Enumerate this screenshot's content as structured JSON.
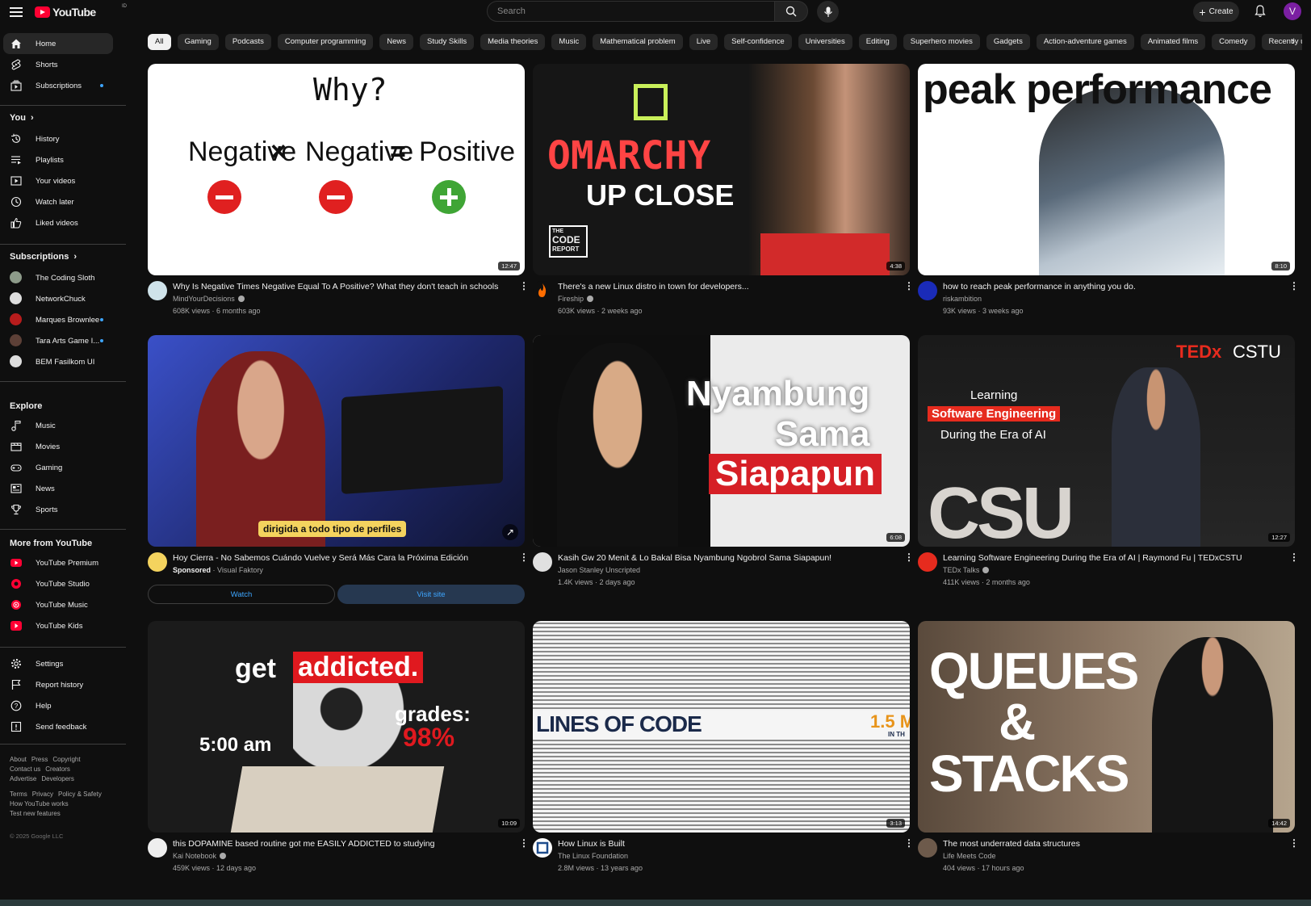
{
  "app": {
    "name": "YouTube",
    "region_code": "ID"
  },
  "header": {
    "search_placeholder": "Search",
    "create_label": "Create",
    "avatar_letter": "V"
  },
  "sidebar": {
    "main": [
      {
        "label": "Home",
        "icon": "home-icon",
        "active": true
      },
      {
        "label": "Shorts",
        "icon": "shorts-icon"
      },
      {
        "label": "Subscriptions",
        "icon": "subscriptions-icon",
        "dot": true
      }
    ],
    "you_header": "You",
    "you": [
      {
        "label": "History",
        "icon": "history-icon"
      },
      {
        "label": "Playlists",
        "icon": "playlists-icon"
      },
      {
        "label": "Your videos",
        "icon": "your-videos-icon"
      },
      {
        "label": "Watch later",
        "icon": "watch-later-icon"
      },
      {
        "label": "Liked videos",
        "icon": "liked-videos-icon"
      }
    ],
    "subs_header": "Subscriptions",
    "subs": [
      {
        "label": "The Coding Sloth",
        "color": "#8d9b8a"
      },
      {
        "label": "NetworkChuck",
        "color": "#dddddd"
      },
      {
        "label": "Marques Brownlee",
        "color": "#b71c1c",
        "dot": true
      },
      {
        "label": "Tara Arts Game I...",
        "color": "#5d4037",
        "dot": true
      },
      {
        "label": "BEM Fasilkom UI",
        "color": "#dddddd"
      }
    ],
    "explore_header": "Explore",
    "explore": [
      {
        "label": "Music",
        "icon": "music-icon"
      },
      {
        "label": "Movies",
        "icon": "movies-icon"
      },
      {
        "label": "Gaming",
        "icon": "gaming-icon"
      },
      {
        "label": "News",
        "icon": "news-icon"
      },
      {
        "label": "Sports",
        "icon": "sports-icon"
      }
    ],
    "more_header": "More from YouTube",
    "more": [
      {
        "label": "YouTube Premium",
        "icon": "youtube-premium-icon"
      },
      {
        "label": "YouTube Studio",
        "icon": "youtube-studio-icon"
      },
      {
        "label": "YouTube Music",
        "icon": "youtube-music-icon"
      },
      {
        "label": "YouTube Kids",
        "icon": "youtube-kids-icon"
      }
    ],
    "settings": [
      {
        "label": "Settings",
        "icon": "gear-icon"
      },
      {
        "label": "Report history",
        "icon": "flag-icon"
      },
      {
        "label": "Help",
        "icon": "help-icon"
      },
      {
        "label": "Send feedback",
        "icon": "feedback-icon"
      }
    ],
    "footer1": [
      "About",
      "Press",
      "Copyright",
      "Contact us",
      "Creators",
      "Advertise",
      "Developers"
    ],
    "footer2": [
      "Terms",
      "Privacy",
      "Policy & Safety",
      "How YouTube works",
      "Test new features"
    ],
    "copyright": "© 2025 Google LLC"
  },
  "chips": [
    "All",
    "Gaming",
    "Podcasts",
    "Computer programming",
    "News",
    "Study Skills",
    "Media theories",
    "Music",
    "Mathematical problem",
    "Live",
    "Self-confidence",
    "Universities",
    "Editing",
    "Superhero movies",
    "Gadgets",
    "Action-adventure games",
    "Animated films",
    "Comedy",
    "Recently uploaded"
  ],
  "videos": [
    {
      "title": "Why Is Negative Times Negative Equal To A Positive? What they don't teach in schools",
      "channel": "MindYourDecisions",
      "verified": true,
      "meta": "608K views · 6 months ago",
      "duration": "12:47",
      "thumb_text": [
        "Why?",
        "Negative",
        "×",
        "Negative",
        "=",
        "Positive"
      ]
    },
    {
      "title": "There's a new Linux distro in town for developers...",
      "channel": "Fireship",
      "verified": true,
      "meta": "603K views · 2 weeks ago",
      "duration": "4:38",
      "thumb_text": [
        "OMARCHY",
        "UP CLOSE",
        "THE",
        "CODE",
        "REPORT"
      ]
    },
    {
      "title": "how to reach peak performance in anything you do.",
      "channel": "riskambition",
      "verified": false,
      "meta": "93K views · 3 weeks ago",
      "duration": "8:10",
      "thumb_text": [
        "peak performance"
      ]
    },
    {
      "title": "Hoy Cierra - No Sabemos Cuándo Vuelve y Será Más Cara la Próxima Edición",
      "sponsored": "Sponsored",
      "channel": "Visual Faktory",
      "watch_label": "Watch",
      "visit_label": "Visit site",
      "thumb_text": [
        "dirigida a todo tipo de perfiles"
      ]
    },
    {
      "title": "Kasih Gw 20 Menit & Lo Bakal Bisa Nyambung Ngobrol Sama Siapapun!",
      "channel": "Jason Stanley Unscripted",
      "verified": false,
      "meta": "1.4K views · 2 days ago",
      "duration": "6:08",
      "thumb_text": [
        "Nyambung",
        "Sama",
        "Siapapun"
      ]
    },
    {
      "title": "Learning Software Engineering During the Era of AI | Raymond Fu | TEDxCSTU",
      "channel": "TEDx Talks",
      "verified": true,
      "meta": "411K views · 2 months ago",
      "duration": "12:27",
      "thumb_text": [
        "TEDx",
        "CSTU",
        "Learning",
        "Software Engineering",
        "During the Era of AI",
        "CSU"
      ]
    },
    {
      "title": "this DOPAMINE based routine got me EASILY ADDICTED to studying",
      "channel": "Kai Notebook",
      "verified": true,
      "meta": "459K views · 12 days ago",
      "duration": "10:09",
      "thumb_text": [
        "get",
        "addicted.",
        "grades:",
        "98%",
        "5:00 am"
      ]
    },
    {
      "title": "How Linux is Built",
      "channel": "The Linux Foundation",
      "verified": false,
      "meta": "2.8M views · 13 years ago",
      "duration": "3:13",
      "thumb_text": [
        "LINES OF CODE",
        "1.5 M",
        "IN TH"
      ]
    },
    {
      "title": "The most underrated data structures",
      "channel": "Life Meets Code",
      "verified": false,
      "meta": "404 views · 17 hours ago",
      "duration": "14:42",
      "thumb_text": [
        "QUEUES",
        "&",
        "STACKS"
      ]
    }
  ]
}
